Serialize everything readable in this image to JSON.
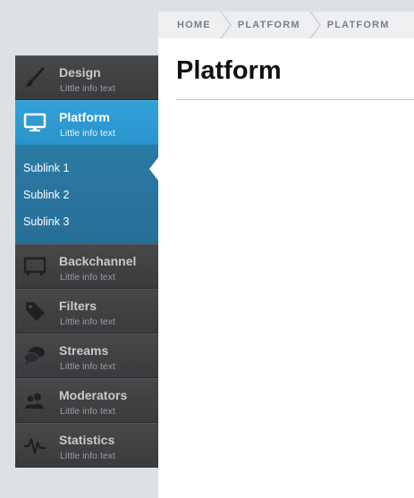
{
  "breadcrumb": {
    "items": [
      "HOME",
      "PLATFORM",
      "PLATFORM"
    ]
  },
  "main": {
    "title": "Platform"
  },
  "nav": {
    "items": [
      {
        "label": "Design",
        "sub": "Little info text",
        "icon": "brush-icon"
      },
      {
        "label": "Platform",
        "sub": "Little info text",
        "icon": "monitor-icon",
        "active": true
      },
      {
        "label": "Backchannel",
        "sub": "Little info text",
        "icon": "screen-icon"
      },
      {
        "label": "Filters",
        "sub": "Little info text",
        "icon": "tag-icon"
      },
      {
        "label": "Streams",
        "sub": "Little info text",
        "icon": "chat-bubbles-icon"
      },
      {
        "label": "Moderators",
        "sub": "Little info text",
        "icon": "users-icon"
      },
      {
        "label": "Statistics",
        "sub": "Little info text",
        "icon": "pulse-icon"
      }
    ],
    "sublinks": [
      "Sublink 1",
      "Sublink 2",
      "Sublink 3"
    ]
  },
  "colors": {
    "accent": "#2f9bd4",
    "sublink_bg": "#2877a1",
    "nav_bg": "#3f4042",
    "page_bg": "#dde1e4"
  }
}
